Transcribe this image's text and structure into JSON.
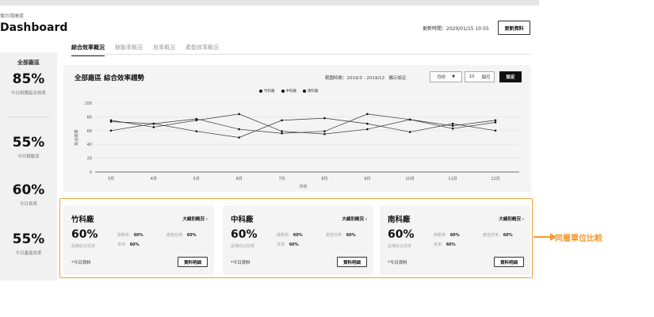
{
  "breadcrumb": "儀台儲康度",
  "page_title": "Dashboard",
  "update_time": "更新時間：2020/01/15 10:55",
  "update_button": "更新資料",
  "tabs": [
    {
      "label": "綜合效率概況",
      "active": true
    },
    {
      "label": "稼動率概況",
      "active": false
    },
    {
      "label": "良率概況",
      "active": false
    },
    {
      "label": "產能效率概況",
      "active": false
    }
  ],
  "sidebar": {
    "plant": "全部廠區",
    "metrics": [
      {
        "value": "85%",
        "label": "今日設備綜合效率"
      },
      {
        "value": "55%",
        "label": "今日稼動率"
      },
      {
        "value": "60%",
        "label": "今日良率"
      },
      {
        "value": "55%",
        "label": "今日產能效率"
      }
    ]
  },
  "chart_panel": {
    "title": "全部廠區 綜合效率趨勢",
    "range": "範圍時間：2019/3 - 2019/12",
    "display_setting": "顯示設定",
    "unit_select": "月份",
    "count_value": "10",
    "count_unit": "個月",
    "set_button": "設定"
  },
  "chart_data": {
    "type": "line",
    "title": "全部廠區 綜合效率趨勢",
    "xlabel": "月份",
    "ylabel": "綜合效率",
    "categories": [
      "3月",
      "4月",
      "5月",
      "6月",
      "7月",
      "8月",
      "9月",
      "10月",
      "11月",
      "12月"
    ],
    "ylim": [
      0,
      100
    ],
    "yticks": [
      0,
      20,
      40,
      60,
      80,
      100
    ],
    "series": [
      {
        "name": "竹科廠",
        "values": [
          75,
          65,
          75,
          84,
          59,
          55,
          62,
          76,
          67,
          75
        ]
      },
      {
        "name": "中科廠",
        "values": [
          60,
          70,
          59,
          50,
          75,
          78,
          70,
          58,
          70,
          60
        ]
      },
      {
        "name": "南科廠",
        "values": [
          73,
          70,
          77,
          62,
          56,
          59,
          84,
          76,
          63,
          72
        ]
      }
    ],
    "grid": true,
    "legend": "top-center"
  },
  "plants": [
    {
      "name": "竹科廠",
      "detail_link": "大線別概況 ›",
      "oee": "60%",
      "oee_label": "設備綜合效率",
      "avail_label": "稼動率:",
      "avail": "60%",
      "perf_label": "產能效率:",
      "perf": "60%",
      "yield_label": "良率:",
      "yield": "60%",
      "footnote": "*今日資料",
      "button": "資料明細"
    },
    {
      "name": "中科廠",
      "detail_link": "大線別概況 ›",
      "oee": "60%",
      "oee_label": "設備綜合效率",
      "avail_label": "稼動率:",
      "avail": "60%",
      "perf_label": "產能效率:",
      "perf": "60%",
      "yield_label": "良率:",
      "yield": "60%",
      "footnote": "*今日資料",
      "button": "資料明細"
    },
    {
      "name": "南科廠",
      "detail_link": "大線別概況 ›",
      "oee": "60%",
      "oee_label": "設備綜合效率",
      "avail_label": "稼動率:",
      "avail": "60%",
      "perf_label": "產能效率:",
      "perf": "60%",
      "yield_label": "良率:",
      "yield": "60%",
      "footnote": "*今日資料",
      "button": "資料明細"
    }
  ],
  "annotation": {
    "label": "同層單位比較",
    "color": "#f39a2c"
  }
}
